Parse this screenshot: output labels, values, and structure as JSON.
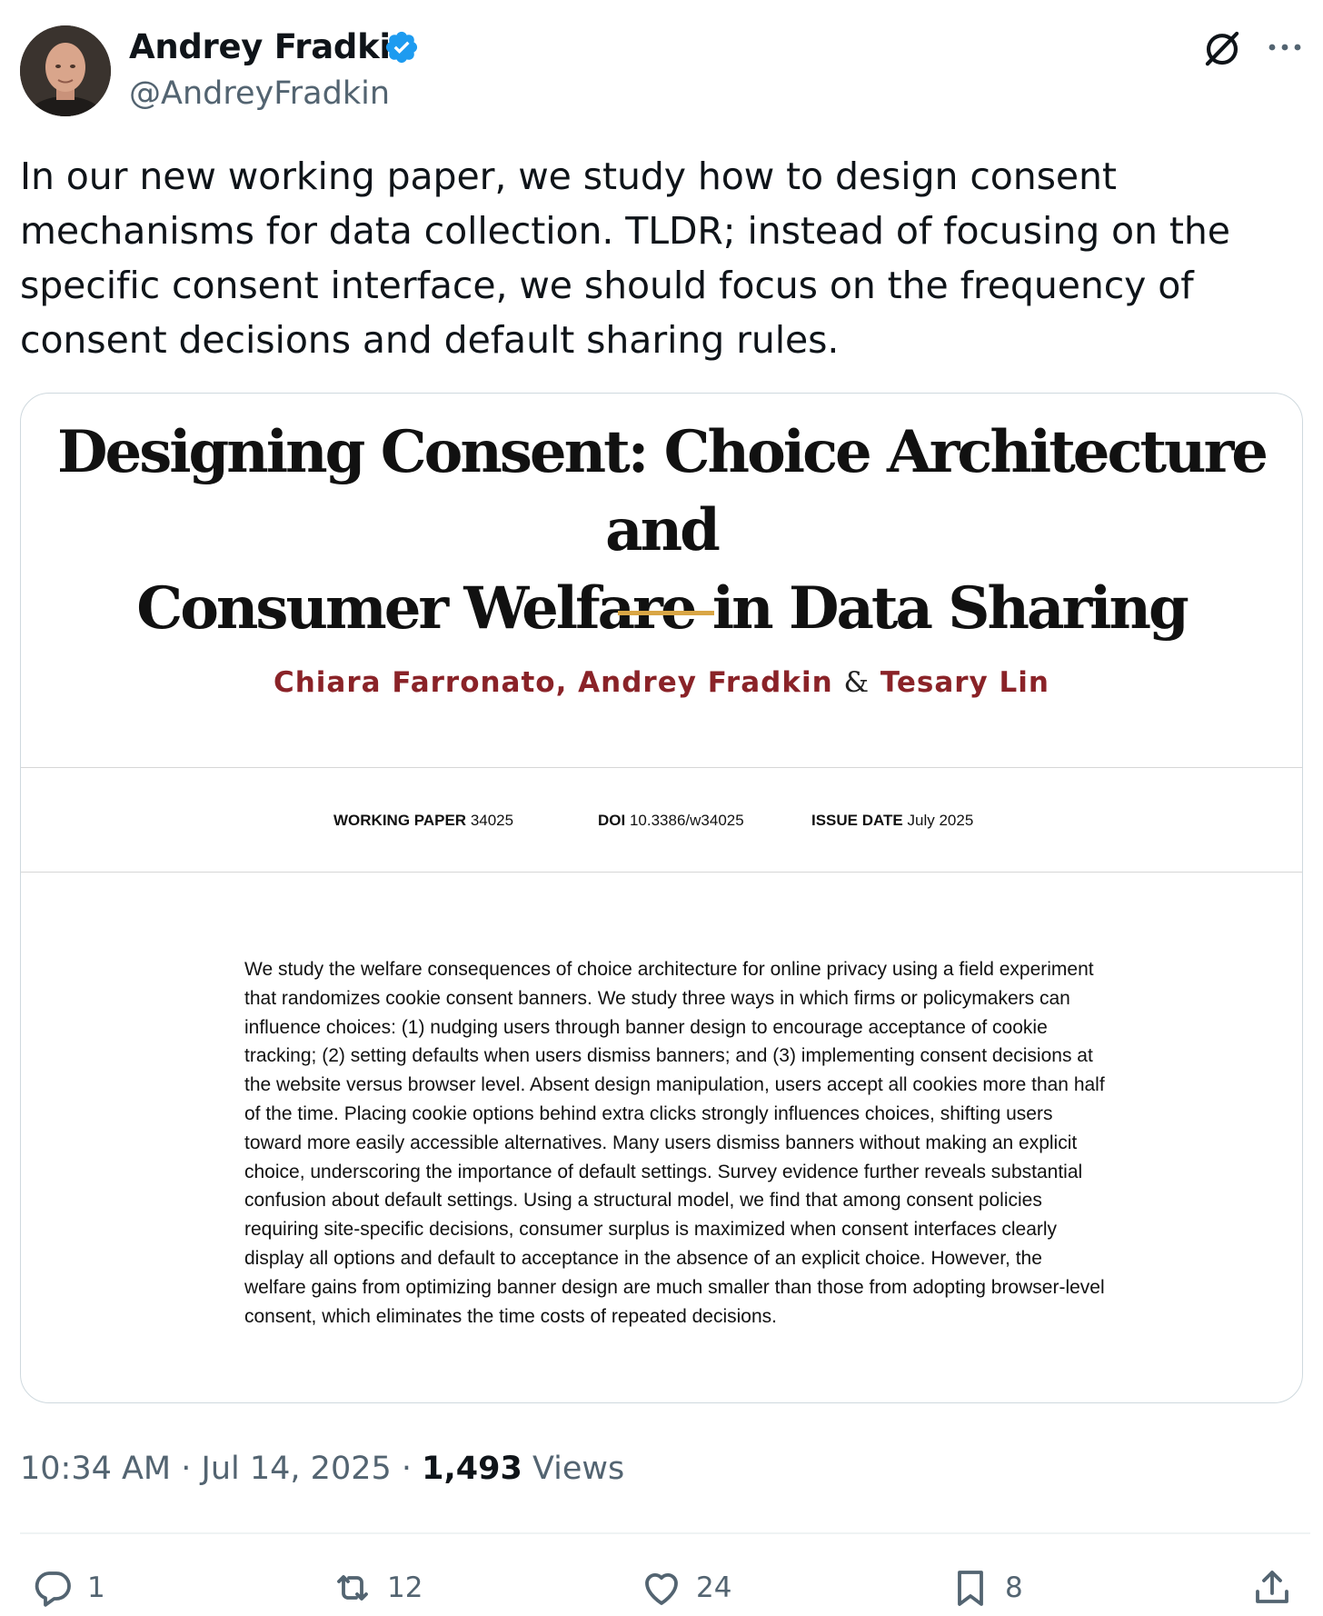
{
  "author": {
    "name": "Andrey Fradkin",
    "handle": "@AndreyFradkin",
    "verified": true
  },
  "header_icons": [
    "grok-icon",
    "more-options-icon"
  ],
  "tweet": {
    "text": "In our new working paper, we study how to design consent mechanisms for data collection. TLDR; instead of focusing on the specific consent interface, we should focus on the frequency of consent decisions and default sharing rules."
  },
  "card": {
    "title_line1": "Designing Consent: Choice Architecture and",
    "title_line2": "Consumer Welfare in Data Sharing",
    "authors": {
      "author1": "Chiara Farronato",
      "separator": ",",
      "author2": "Andrey Fradkin",
      "amp": "&",
      "author3": "Tesary Lin"
    },
    "meta": {
      "wp_label": "WORKING PAPER",
      "wp_value": "34025",
      "doi_label": "DOI",
      "doi_value": "10.3386/w34025",
      "issue_label": "ISSUE DATE",
      "issue_value": "July 2025"
    },
    "abstract": "We study the welfare consequences of choice architecture for online privacy using a field experiment that randomizes cookie consent banners. We study three ways in which firms or policymakers can influence choices: (1) nudging users through banner design to encourage acceptance of cookie tracking; (2) setting defaults when users dismiss banners; and (3) implementing consent decisions at the website versus browser level. Absent design manipulation, users accept all cookies more than half of the time. Placing cookie options behind extra clicks strongly influences choices, shifting users toward more easily accessible alternatives. Many users dismiss banners without making an explicit choice, underscoring the importance of default settings. Survey evidence further reveals substantial confusion about default settings. Using a structural model, we find that among consent policies requiring site-specific decisions, consumer surplus is maximized when consent interfaces clearly display all options and default to acceptance in the absence of an explicit choice. However, the welfare gains from optimizing banner design are much smaller than those from adopting browser-level consent, which eliminates the time costs of repeated decisions."
  },
  "timestamp": {
    "time": "10:34 AM",
    "sep1": " · ",
    "date": "Jul 14, 2025",
    "sep2": " · ",
    "views": "1,493",
    "views_label": " Views"
  },
  "actions": {
    "replies": "1",
    "reposts": "12",
    "likes": "24",
    "bookmarks": "8"
  },
  "colors": {
    "verified_blue": "#1d9bf0",
    "author_red": "#8a2328",
    "gold_rule": "#d9a645",
    "muted_gray": "#536471"
  }
}
